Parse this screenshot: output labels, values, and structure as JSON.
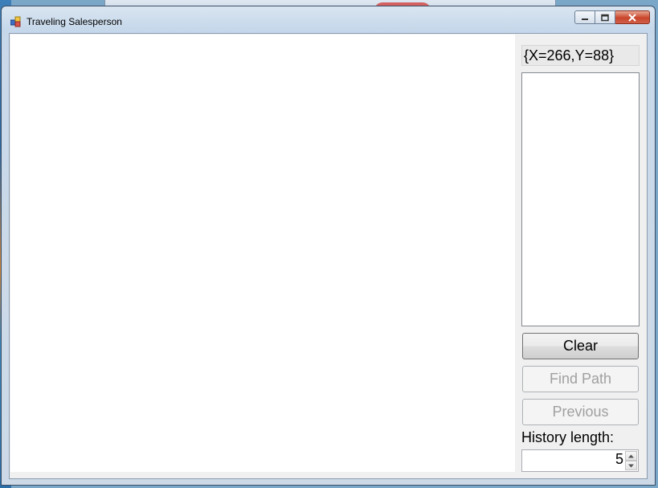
{
  "window": {
    "title": "Traveling Salesperson",
    "icons": {
      "app": "app-icon",
      "minimize": "minimize-icon",
      "maximize": "maximize-icon",
      "close": "close-icon"
    }
  },
  "sidebar": {
    "coordinate_readout": "{X=266,Y=88}",
    "list_items": [],
    "buttons": {
      "clear": "Clear",
      "find_path": "Find Path",
      "previous": "Previous"
    },
    "history": {
      "label": "History length:",
      "value": "5"
    }
  },
  "colors": {
    "canvas_bg": "#ffffff",
    "panel_bg": "#f0f0f0",
    "disabled_text": "#a0a0a0"
  }
}
